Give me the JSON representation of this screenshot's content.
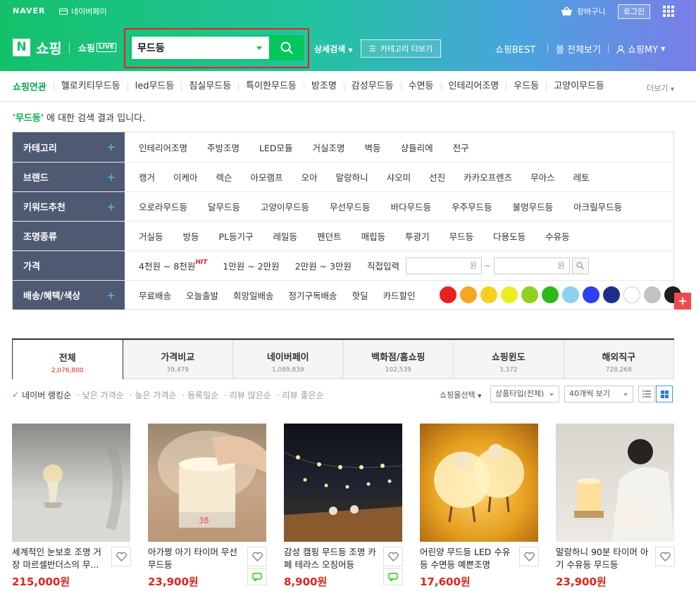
{
  "header": {
    "naver": "NAVER",
    "naverpay": "네이버페이",
    "cart": "장바구니",
    "login": "로그인",
    "shopping": "쇼핑",
    "live": "쇼핑",
    "live_badge": "LIVE",
    "search_value": "무드등",
    "detail_search": "상세검색",
    "category_more": "카테고리 더보기",
    "best": "쇼핑BEST",
    "all_malls": "몰 전체보기",
    "my": "쇼핑MY"
  },
  "related": {
    "label": "쇼핑연관",
    "items": [
      "헬로키티무드등",
      "led무드등",
      "침실무드등",
      "특이한무드등",
      "방조명",
      "감성무드등",
      "수면등",
      "인테리어조명",
      "우드등",
      "고양이무드등"
    ],
    "more": "더보기"
  },
  "result": {
    "keyword": "'무드등'",
    "suffix": " 에 대한 검색 결과 입니다."
  },
  "filters": [
    {
      "head": "카테고리",
      "plus": true,
      "items": [
        "인테리어조명",
        "주방조명",
        "LED모듈",
        "거실조명",
        "벽등",
        "샹들리에",
        "전구"
      ]
    },
    {
      "head": "브랜드",
      "plus": true,
      "items": [
        "캥거",
        "이케아",
        "렉슨",
        "아모램프",
        "오아",
        "말랑하니",
        "샤오미",
        "선진",
        "카카오프렌즈",
        "무아스",
        "레토"
      ]
    },
    {
      "head": "키워드추천",
      "plus": true,
      "items": [
        "오로라무드등",
        "달무드등",
        "고양이무드등",
        "무선무드등",
        "바다무드등",
        "우주무드등",
        "불멍무드등",
        "아크릴무드등"
      ]
    },
    {
      "head": "조명종류",
      "plus": false,
      "items": [
        "거실등",
        "방등",
        "PL등기구",
        "레일등",
        "펜던트",
        "매립등",
        "투광기",
        "무드등",
        "다용도등",
        "수유등"
      ]
    },
    {
      "head": "가격",
      "plus": false,
      "items": [
        "4천원 ~ 8천원",
        "1만원 ~ 2만원",
        "2만원 ~ 3만원",
        "직접입력"
      ]
    },
    {
      "head": "배송/혜택/색상",
      "plus": true,
      "items": [
        "무료배송",
        "오늘출발",
        "희망일배송",
        "정기구독배송",
        "핫딜",
        "카드할인"
      ]
    }
  ],
  "price_hit": "HIT",
  "price_unit": "원",
  "color_swatches": [
    "#e8211c",
    "#f5a623",
    "#f5d020",
    "#e9ef1e",
    "#8fd11e",
    "#2fb81a",
    "#8fcff0",
    "#2f3ff0",
    "#1e2f8a",
    "#ffffff",
    "#c2c2c2",
    "#1e1e1e"
  ],
  "tabs": [
    {
      "label": "전체",
      "count": "2,076,800"
    },
    {
      "label": "가격비교",
      "count": "39,479"
    },
    {
      "label": "네이버페이",
      "count": "1,089,839"
    },
    {
      "label": "백화점/홈쇼핑",
      "count": "102,539"
    },
    {
      "label": "쇼핑윈도",
      "count": "3,372"
    },
    {
      "label": "해외직구",
      "count": "728,268"
    }
  ],
  "sort": {
    "active": "네이버 랭킹순",
    "options": [
      "낮은 가격순",
      "높은 가격순",
      "등록일순",
      "리뷰 많은순",
      "리뷰 좋은순"
    ],
    "mall_select": "쇼핑몰선택",
    "product_type": "상품타입(전체)",
    "page_size": "40개씩 보기"
  },
  "products": [
    {
      "title": "세계적인 눈보호 조명 거장 마르셀반더스의 무...",
      "price": "215,000원"
    },
    {
      "title": "아가짱 아기 타이머 무선 무드등",
      "price": "23,900원"
    },
    {
      "title": "감성 캠핑 무드등 조명 카페 테라스 오징어등",
      "price": "8,900원"
    },
    {
      "title": "어린양 무드등 LED 수유등 수면등 예쁜조명",
      "price": "17,600원"
    },
    {
      "title": "말랑하니 90분 타이머 아기 수유등 무드등",
      "price": "23,900원"
    }
  ]
}
